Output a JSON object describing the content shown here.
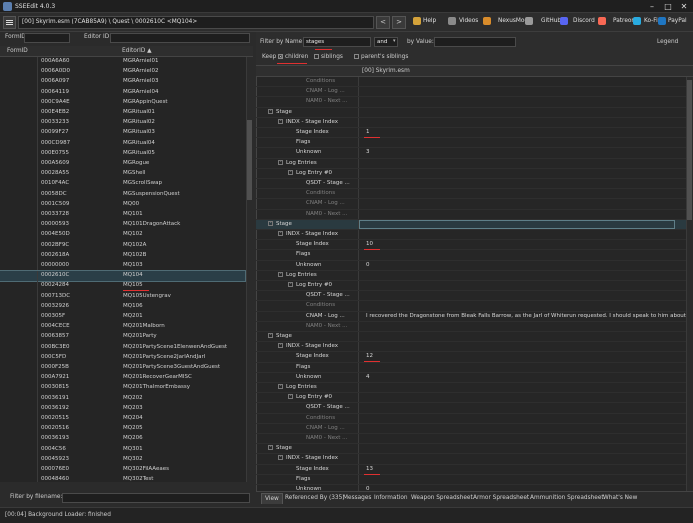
{
  "window": {
    "title": "SSEEdit 4.0.3"
  },
  "toolbar": {
    "path": "[00] Skyrim.esm (7CAB85A9) \\ Quest \\ 0002610C <MQ104>",
    "back_label": "<",
    "forward_label": ">",
    "links": [
      "Help",
      "Videos",
      "NexusMods",
      "GitHub",
      "Discord",
      "Patreon",
      "Ko-Fi",
      "PayPal"
    ],
    "link_colors": [
      "#d4a23a",
      "#8a8a8a",
      "#d98c2b",
      "#9a9a9a",
      "#5865f2",
      "#f96854",
      "#29abe0",
      "#1f76c2"
    ]
  },
  "left_filter": {
    "formid_label": "FormID",
    "editorid_label": "Editor ID"
  },
  "list": {
    "columns": [
      "FormID",
      "EditorID ▲"
    ],
    "rows": [
      [
        "000A6A60",
        "MGRArniel01"
      ],
      [
        "0006A0D0",
        "MGRArniel02"
      ],
      [
        "0006A097",
        "MGRArniel03"
      ],
      [
        "00064119",
        "MGRArniel04"
      ],
      [
        "000C9A4E",
        "MGRAppinQuest"
      ],
      [
        "000E4EB2",
        "MGRitual01"
      ],
      [
        "00033233",
        "MGRitual02"
      ],
      [
        "00099F27",
        "MGRitual03"
      ],
      [
        "000CD987",
        "MGRitual04"
      ],
      [
        "000E0755",
        "MGRitual05"
      ],
      [
        "000A5609",
        "MGRogue"
      ],
      [
        "00028A55",
        "MGShell"
      ],
      [
        "0010F4AC",
        "MGScrollSwap"
      ],
      [
        "00058DC",
        "MGSuspensionQuest"
      ],
      [
        "0001C509",
        "MQ00"
      ],
      [
        "00033728",
        "MQ101"
      ],
      [
        "00000593",
        "MQ101DragonAttack"
      ],
      [
        "0004E50D",
        "MQ102"
      ],
      [
        "0002BF9C",
        "MQ102A"
      ],
      [
        "0002618A",
        "MQ102B"
      ],
      [
        "00000000",
        "MQ103"
      ],
      [
        "0002610C",
        "MQ104"
      ],
      [
        "00024284",
        "MQ105"
      ],
      [
        "000713DC",
        "MQ105Ustengrav"
      ],
      [
        "00032926",
        "MQ106"
      ],
      [
        "000305F",
        "MQ201"
      ],
      [
        "0004CECE",
        "MQ201Malborn"
      ],
      [
        "00063857",
        "MQ201Party"
      ],
      [
        "000BC3E0",
        "MQ201PartyScene1ElenwenAndGuest"
      ],
      [
        "000C5FD",
        "MQ201PartyScene2JarlAndJarl"
      ],
      [
        "0000F25B",
        "MQ201PartyScene3GuestAndGuest"
      ],
      [
        "000A7921",
        "MQ201RecoverGearMISC"
      ],
      [
        "00030815",
        "MQ201ThalmorEmbassy"
      ],
      [
        "00036191",
        "MQ202"
      ],
      [
        "00036192",
        "MQ203"
      ],
      [
        "00020515",
        "MQ204"
      ],
      [
        "00020516",
        "MQ205"
      ],
      [
        "00036193",
        "MQ206"
      ],
      [
        "0004C56",
        "MQ301"
      ],
      [
        "00045923",
        "MQ302"
      ],
      [
        "000076E0",
        "MQ302FilAAeaes"
      ],
      [
        "00048460",
        "MQ302Test"
      ],
      [
        "00046550",
        "MQ303"
      ]
    ],
    "selected_index": 21
  },
  "filename_filter": {
    "label": "Filter by filename:"
  },
  "status": {
    "text": "[00:04] Background Loader: finished"
  },
  "right_filter": {
    "by_name_label": "Filter by Name",
    "name_value": "stages",
    "op_value": "and",
    "by_value_label": "by Value:",
    "legend_label": "Legend",
    "keep_label": "Keep",
    "children_label": "children",
    "siblings_label": "siblings",
    "parents_siblings_label": "parent's siblings",
    "children_checked": true
  },
  "record_header": "[00] Skyrim.esm",
  "tree": [
    {
      "indent": 3,
      "label": "Conditions",
      "value": "",
      "dim": true
    },
    {
      "indent": 3,
      "label": "CNAM - Log ...",
      "value": "",
      "dim": true
    },
    {
      "indent": 3,
      "label": "NAM0 - Next ...",
      "value": "",
      "dim": true
    },
    {
      "indent": 0,
      "tog": "-",
      "label": "Stage",
      "value": ""
    },
    {
      "indent": 1,
      "tog": "-",
      "label": "INDX - Stage Index",
      "value": ""
    },
    {
      "indent": 2,
      "label": "Stage Index",
      "value": "1",
      "mark": true
    },
    {
      "indent": 2,
      "label": "Flags",
      "value": ""
    },
    {
      "indent": 2,
      "label": "Unknown",
      "value": "3"
    },
    {
      "indent": 1,
      "tog": "-",
      "label": "Log Entries",
      "value": ""
    },
    {
      "indent": 2,
      "tog": "-",
      "label": "Log Entry #0",
      "value": ""
    },
    {
      "indent": 3,
      "label": "QSDT - Stage ...",
      "value": ""
    },
    {
      "indent": 3,
      "label": "Conditions",
      "value": "",
      "dim": true
    },
    {
      "indent": 3,
      "label": "CNAM - Log ...",
      "value": "",
      "dim": true
    },
    {
      "indent": 3,
      "label": "NAM0 - Next ...",
      "value": "",
      "dim": true
    },
    {
      "indent": 0,
      "tog": "-",
      "label": "Stage",
      "value": "",
      "hl": true
    },
    {
      "indent": 1,
      "tog": "-",
      "label": "INDX - Stage Index",
      "value": ""
    },
    {
      "indent": 2,
      "label": "Stage Index",
      "value": "10",
      "mark": true
    },
    {
      "indent": 2,
      "label": "Flags",
      "value": ""
    },
    {
      "indent": 2,
      "label": "Unknown",
      "value": "0"
    },
    {
      "indent": 1,
      "tog": "-",
      "label": "Log Entries",
      "value": ""
    },
    {
      "indent": 2,
      "tog": "-",
      "label": "Log Entry #0",
      "value": ""
    },
    {
      "indent": 3,
      "label": "QSDT - Stage ...",
      "value": ""
    },
    {
      "indent": 3,
      "label": "Conditions",
      "value": "",
      "dim": true
    },
    {
      "indent": 3,
      "label": "CNAM - Log ...",
      "value": "I recovered the Dragonstone from Bleak Falls Barrow, as the Jarl of Whiterun requested. I should speak to him about..."
    },
    {
      "indent": 3,
      "label": "NAM0 - Next ...",
      "value": "",
      "dim": true
    },
    {
      "indent": 0,
      "tog": "-",
      "label": "Stage",
      "value": ""
    },
    {
      "indent": 1,
      "tog": "-",
      "label": "INDX - Stage Index",
      "value": ""
    },
    {
      "indent": 2,
      "label": "Stage Index",
      "value": "12",
      "mark": true
    },
    {
      "indent": 2,
      "label": "Flags",
      "value": ""
    },
    {
      "indent": 2,
      "label": "Unknown",
      "value": "4"
    },
    {
      "indent": 1,
      "tog": "-",
      "label": "Log Entries",
      "value": ""
    },
    {
      "indent": 2,
      "tog": "-",
      "label": "Log Entry #0",
      "value": ""
    },
    {
      "indent": 3,
      "label": "QSDT - Stage ...",
      "value": ""
    },
    {
      "indent": 3,
      "label": "Conditions",
      "value": "",
      "dim": true
    },
    {
      "indent": 3,
      "label": "CNAM - Log ...",
      "value": "",
      "dim": true
    },
    {
      "indent": 3,
      "label": "NAM0 - Next ...",
      "value": "",
      "dim": true
    },
    {
      "indent": 0,
      "tog": "-",
      "label": "Stage",
      "value": ""
    },
    {
      "indent": 1,
      "tog": "-",
      "label": "INDX - Stage Index",
      "value": ""
    },
    {
      "indent": 2,
      "label": "Stage Index",
      "value": "13",
      "mark": true
    },
    {
      "indent": 2,
      "label": "Flags",
      "value": ""
    },
    {
      "indent": 2,
      "label": "Unknown",
      "value": "0"
    }
  ],
  "tabs": [
    "View",
    "Referenced By (335)",
    "Messages",
    "Information",
    "Weapon Spreadsheet",
    "Armor Spreadsheet",
    "Ammunition Spreadsheet",
    "What's New"
  ]
}
